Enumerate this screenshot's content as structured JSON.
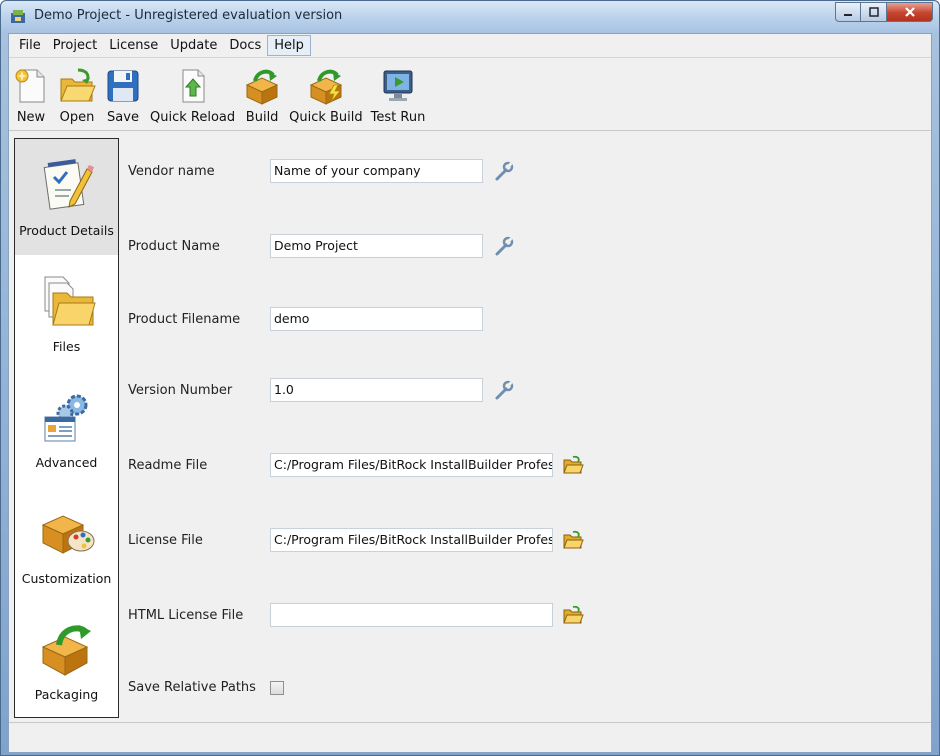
{
  "window": {
    "title": "Demo Project - Unregistered evaluation version"
  },
  "menu": {
    "items": [
      "File",
      "Project",
      "License",
      "Update",
      "Docs",
      "Help"
    ]
  },
  "toolbar": {
    "new_label": "New",
    "open_label": "Open",
    "save_label": "Save",
    "quick_reload_label": "Quick Reload",
    "build_label": "Build",
    "quick_build_label": "Quick Build",
    "test_run_label": "Test Run"
  },
  "sidebar": {
    "items": [
      {
        "label": "Product Details",
        "icon": "notepad-pencil-icon",
        "selected": true
      },
      {
        "label": "Files",
        "icon": "files-folder-icon",
        "selected": false
      },
      {
        "label": "Advanced",
        "icon": "gears-window-icon",
        "selected": false
      },
      {
        "label": "Customization",
        "icon": "box-palette-icon",
        "selected": false
      },
      {
        "label": "Packaging",
        "icon": "box-arrow-icon",
        "selected": false
      }
    ]
  },
  "form": {
    "vendor_name": {
      "label": "Vendor name",
      "value": "Name of your company"
    },
    "product_name": {
      "label": "Product Name",
      "value": "Demo Project"
    },
    "product_filename": {
      "label": "Product Filename",
      "value": "demo"
    },
    "version_number": {
      "label": "Version Number",
      "value": "1.0"
    },
    "readme_file": {
      "label": "Readme File",
      "value": "C:/Program Files/BitRock InstallBuilder Profes"
    },
    "license_file": {
      "label": "License File",
      "value": "C:/Program Files/BitRock InstallBuilder Profes"
    },
    "html_license_file": {
      "label": "HTML License File",
      "value": ""
    },
    "save_relative_paths": {
      "label": "Save Relative Paths",
      "checked": false
    }
  },
  "colors": {
    "accent": "#4a78b0",
    "selection": "#e2e2e2",
    "close_button": "#c7452f"
  }
}
